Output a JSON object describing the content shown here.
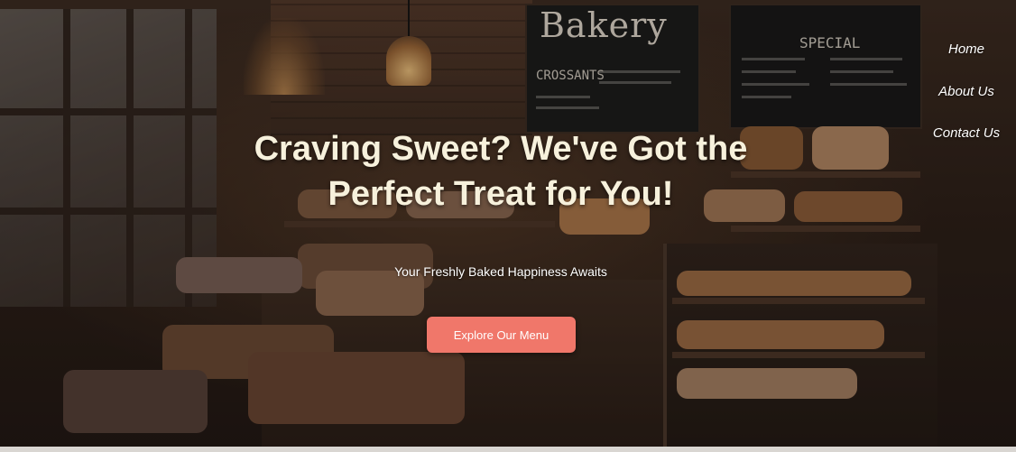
{
  "nav": {
    "items": [
      {
        "label": "Home"
      },
      {
        "label": "About Us"
      },
      {
        "label": "Contact Us"
      }
    ]
  },
  "hero": {
    "headline": "Craving Sweet? We've Got the Perfect Treat for You!",
    "subheadline": "Your Freshly Baked Happiness Awaits",
    "cta_label": "Explore Our Menu",
    "background_image": "bakery-interior-photo"
  },
  "background_signage": {
    "brand": "Bakery",
    "left_board_heading": "CROSSANTS",
    "right_board_heading": "SPECIAL"
  },
  "colors": {
    "cta_background": "#f0776a",
    "headline_text": "#f7f1dc",
    "nav_text": "#ffffff"
  }
}
